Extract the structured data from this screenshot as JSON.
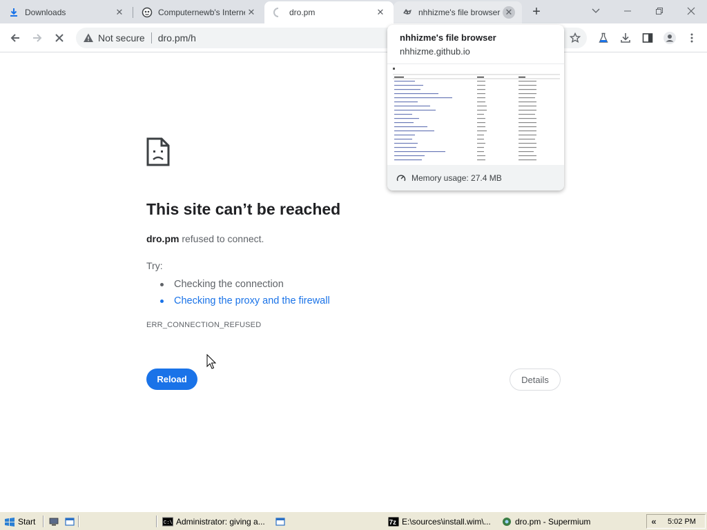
{
  "tabs": [
    {
      "title": "Downloads",
      "icon": "download-icon",
      "state": "normal"
    },
    {
      "title": "Computernewb's Interne",
      "icon": "computernewb-favicon",
      "state": "normal"
    },
    {
      "title": "dro.pm",
      "icon": "loading-spinner-icon",
      "state": "active"
    },
    {
      "title": "nhhizme's file browser",
      "icon": "nhhizme-favicon",
      "state": "hovered"
    }
  ],
  "new_tab_label": "+",
  "toolbar": {
    "security_label": "Not secure",
    "url": "dro.pm/h"
  },
  "error": {
    "title": "This site can’t be reached",
    "host": "dro.pm",
    "desc_suffix": " refused to connect.",
    "try_label": "Try:",
    "suggestions": [
      "Checking the connection",
      "Checking the proxy and the firewall"
    ],
    "code": "ERR_CONNECTION_REFUSED",
    "reload_label": "Reload",
    "details_label": "Details"
  },
  "hover_card": {
    "title": "nhhizme's file browser",
    "domain": "nhhizme.github.io",
    "memory": "Memory usage: 27.4 MB"
  },
  "taskbar": {
    "start_label": "Start",
    "items": [
      {
        "label": "Administrator:  giving a..."
      },
      {
        "label": "E:\\sources\\install.wim\\..."
      },
      {
        "label": "dro.pm - Supermium"
      }
    ],
    "clock": "5:02 PM"
  },
  "colors": {
    "accent": "#1a73e8",
    "tabstrip": "#dee1e6",
    "taskbar": "#ece9d8"
  }
}
